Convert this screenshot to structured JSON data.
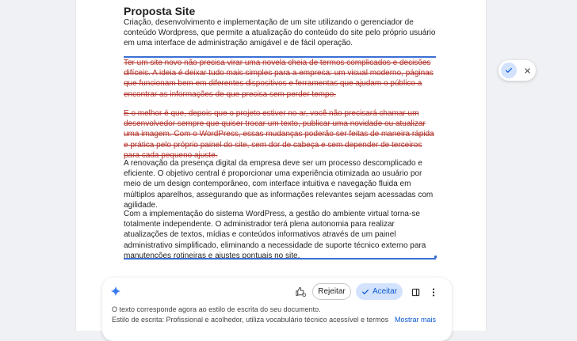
{
  "document": {
    "title": "Proposta Site",
    "intro": "Criação, desenvolvimento e implementação de um site utilizando o gerenciador de conteúdo Wordpress, que permite a atualização do conteúdo do site pelo próprio usuário em uma interface de administração amigável e de fácil operação.",
    "deleted_1": "Ter um site novo não precisa virar uma novela cheia de termos complicados e decisões difíceis. A ideia é deixar tudo mais simples para a empresa: um visual moderno, páginas que funcionam bem em diferentes dispositivos e ferramentas que ajudam o público a encontrar as informações de que precisa sem perder tempo.",
    "deleted_2": "E o melhor é que, depois que o projeto estiver no ar, você não precisará chamar um desenvolvedor sempre que quiser trocar um texto, publicar uma novidade ou atualizar uma imagem. Com o WordPress, essas mudanças poderão ser feitas de maneira rápida e prática pelo próprio painel do site, sem dor de cabeça e sem depender de terceiros para cada pequeno ajuste.",
    "inserted_1": "A renovação da presença digital da empresa deve ser um processo descomplicado e eficiente. O objetivo central é proporcionar uma experiência otimizada ao usuário por meio de um design contemporâneo, com interface intuitiva e navegação fluida em múltiplos aparelhos, assegurando que as informações relevantes sejam acessadas com agilidade.",
    "inserted_2": "Com a implementação do sistema WordPress, a gestão do ambiente virtual torna-se totalmente independente. O administrador terá plena autonomia para realizar atualizações de textos, mídias e conteúdos informativos através de um painel administrativo simplificado, eliminando a necessidade de suporte técnico externo para manutenções rotineiras e ajustes pontuais no site."
  },
  "panel": {
    "reject_label": "Rejeitar",
    "accept_label": "Aceitar",
    "status": "O texto corresponde agora ao estilo de escrita do seu documento.",
    "style_line": "Estilo de escrita: Profissional e acolhedor, utiliza vocabulário técnico acessível e termos",
    "more_label": "Mostrar mais"
  },
  "colors": {
    "accent": "#0b57d0",
    "deleted": "#b3322b",
    "accept_bg": "#d3e3fd"
  },
  "icons": [
    "check-icon",
    "close-icon",
    "gemini-sparkle-icon",
    "thumbs-feedback-icon",
    "side-panel-icon",
    "more-vert-icon"
  ]
}
